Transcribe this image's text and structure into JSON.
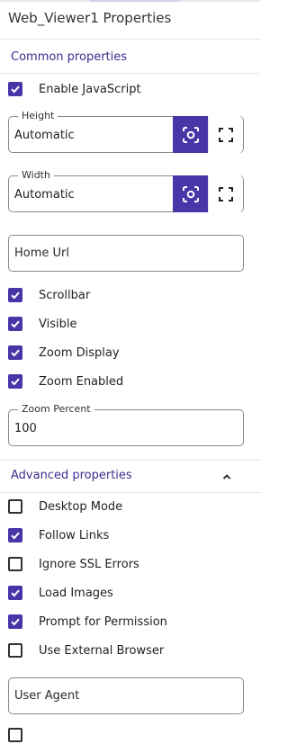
{
  "title": "Web_Viewer1 Properties",
  "colors": {
    "accent": "#4a35a8",
    "section_text": "#3b2d8f"
  },
  "common": {
    "heading": "Common properties",
    "enable_javascript": {
      "label": "Enable JavaScript",
      "checked": true
    },
    "height": {
      "legend": "Height",
      "value": "Automatic"
    },
    "width": {
      "legend": "Width",
      "value": "Automatic"
    },
    "home_url": {
      "placeholder": "Home Url"
    },
    "scrollbar": {
      "label": "Scrollbar",
      "checked": true
    },
    "visible": {
      "label": "Visible",
      "checked": true
    },
    "zoom_display": {
      "label": "Zoom Display",
      "checked": true
    },
    "zoom_enabled": {
      "label": "Zoom Enabled",
      "checked": true
    },
    "zoom_percent": {
      "legend": "Zoom Percent",
      "value": "100"
    }
  },
  "advanced": {
    "heading": "Advanced properties",
    "collapse_icon": "chevron-up-icon",
    "desktop_mode": {
      "label": "Desktop Mode",
      "checked": false
    },
    "follow_links": {
      "label": "Follow Links",
      "checked": true
    },
    "ignore_ssl": {
      "label": "Ignore SSL Errors",
      "checked": false
    },
    "load_images": {
      "label": "Load Images",
      "checked": true
    },
    "prompt_permission": {
      "label": "Prompt for Permission",
      "checked": true
    },
    "use_external_browser": {
      "label": "Use External Browser",
      "checked": false
    },
    "user_agent": {
      "placeholder": "User Agent"
    }
  },
  "icons": {
    "locate": "target-icon",
    "fullscreen": "fullscreen-icon",
    "check": "checkmark-icon"
  }
}
